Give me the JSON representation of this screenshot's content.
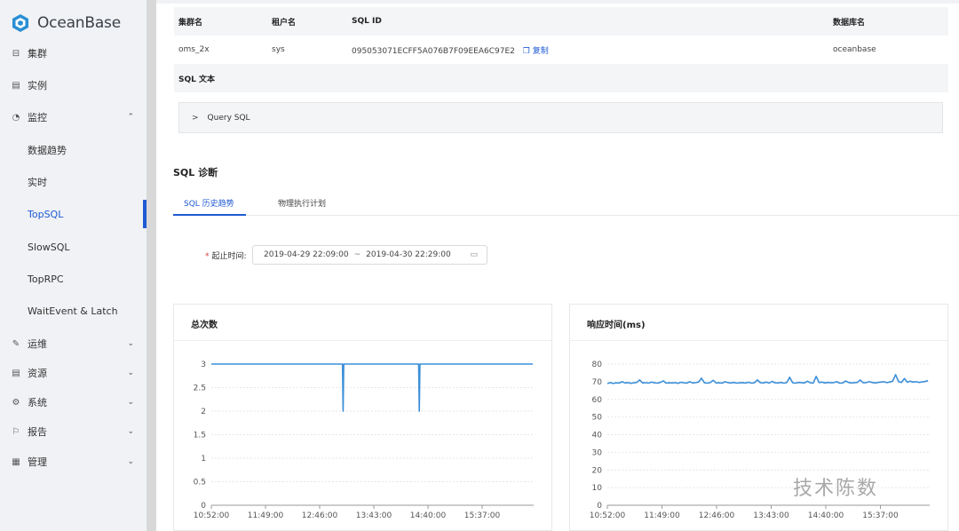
{
  "logo": {
    "text": "OceanBase"
  },
  "sidebar": {
    "items": [
      {
        "label": "集群",
        "icon": "cluster-icon"
      },
      {
        "label": "实例",
        "icon": "instance-icon"
      },
      {
        "label": "监控",
        "icon": "monitor-icon",
        "expanded": true
      },
      {
        "label": "数据趋势"
      },
      {
        "label": "实时"
      },
      {
        "label": "TopSQL",
        "active": true
      },
      {
        "label": "SlowSQL"
      },
      {
        "label": "TopRPC"
      },
      {
        "label": "WaitEvent & Latch"
      },
      {
        "label": "运维",
        "icon": "wrench-icon"
      },
      {
        "label": "资源",
        "icon": "resource-icon"
      },
      {
        "label": "系统",
        "icon": "gear-icon"
      },
      {
        "label": "报告",
        "icon": "flag-icon"
      },
      {
        "label": "管理",
        "icon": "grid-icon"
      }
    ]
  },
  "info": {
    "headers": [
      "集群名",
      "租户名",
      "SQL ID",
      "数据库名"
    ],
    "values": [
      "oms_2x",
      "sys",
      "095053071ECFF5A076B7F09EEA6C97E2",
      "oceanbase"
    ],
    "copy_label": "复制",
    "sql_text_label": "SQL 文本",
    "query_label": "Query SQL"
  },
  "diagnosis": {
    "title": "SQL 诊断",
    "tabs": [
      "SQL 历史趋势",
      "物理执行计划"
    ],
    "range_label": "起止时间:",
    "range_start": "2019-04-29 22:09:00",
    "range_sep": "~",
    "range_end": "2019-04-30 22:29:00"
  },
  "chart_data": [
    {
      "type": "line",
      "title": "总次数",
      "x_ticks": [
        "10:52:00",
        "11:49:00",
        "12:46:00",
        "13:43:00",
        "14:40:00",
        "15:37:00"
      ],
      "y_ticks": [
        "0",
        "0.5",
        "1",
        "1.5",
        "2",
        "2.5",
        "3"
      ],
      "ylim": [
        0,
        3
      ],
      "x": [
        0,
        0.408,
        0.41,
        0.412,
        0.645,
        0.647,
        0.649,
        1
      ],
      "values": [
        3,
        3,
        2,
        3,
        3,
        2,
        3,
        3
      ],
      "color": "#3c8fd8"
    },
    {
      "type": "line",
      "title": "响应时间(ms)",
      "x_ticks": [
        "10:52:00",
        "11:49:00",
        "12:46:00",
        "13:43:00",
        "14:40:00",
        "15:37:00"
      ],
      "y_ticks": [
        "0",
        "10",
        "20",
        "30",
        "40",
        "50",
        "60",
        "70",
        "80"
      ],
      "ylim": [
        0,
        80
      ],
      "values": [
        69,
        69.5,
        69,
        69.4,
        69.2,
        70,
        69.3,
        69.5,
        69.1,
        69.4,
        69.6,
        71,
        69.3,
        69.5,
        69.2,
        69.8,
        69.4,
        69.2,
        69.6,
        70.5,
        69.2,
        69.4,
        69.3,
        69.5,
        69.1,
        69.7,
        69.4,
        69.2,
        70,
        69.3,
        69.5,
        69.8,
        72,
        69.4,
        69.2,
        69.5,
        70.8,
        69.3,
        69.4,
        69.2,
        70,
        69.5,
        69.3,
        69.6,
        69.2,
        69.4,
        69.5,
        69.3,
        69.7,
        69.2,
        69.4,
        71,
        69.5,
        69.3,
        69.8,
        69.2,
        70.2,
        69.4,
        69.3,
        69.6,
        69.2,
        69.5,
        72.5,
        69.4,
        69.2,
        69.6,
        69.5,
        69.3,
        70.3,
        69.4,
        69.2,
        73,
        69.5,
        69.8,
        69.3,
        69.6,
        69.4,
        69.5,
        70,
        69.2,
        69.3,
        70.4,
        69.6,
        69.3,
        69.5,
        69.6,
        71,
        69.4,
        69.5,
        70,
        69.6,
        69.3,
        69.6,
        69.8,
        70,
        69.5,
        69.8,
        70.3,
        74,
        70.1,
        69.6,
        71.8,
        69.7,
        70.3,
        69.8,
        70,
        69.6,
        69.9,
        70.1,
        70.6
      ],
      "color": "#3c8fd8"
    }
  ],
  "watermark": "技术陈数"
}
